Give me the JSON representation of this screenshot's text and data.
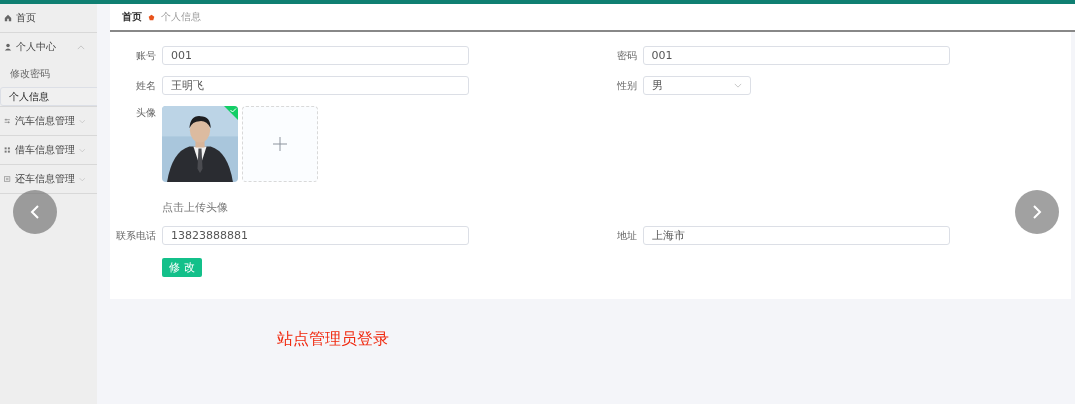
{
  "sidebar": {
    "items": [
      {
        "label": "首页"
      },
      {
        "label": "个人中心",
        "expanded": true,
        "children": [
          {
            "label": "修改密码",
            "selected": false
          },
          {
            "label": "个人信息",
            "selected": true
          }
        ]
      },
      {
        "label": "汽车信息管理",
        "expanded": false
      },
      {
        "label": "借车信息管理",
        "expanded": false
      },
      {
        "label": "还车信息管理",
        "expanded": false
      }
    ]
  },
  "breadcrumb": [
    {
      "label": "首页",
      "current": false
    },
    {
      "label": "个人信息",
      "current": true
    }
  ],
  "form": {
    "rows": [
      [
        {
          "kind": "text",
          "label": "账号",
          "value": "001"
        },
        {
          "kind": "text",
          "label": "密码",
          "value": "001"
        }
      ],
      [
        {
          "kind": "text",
          "label": "姓名",
          "value": "王明飞"
        },
        {
          "kind": "select",
          "label": "性别",
          "value": "男"
        }
      ],
      [
        {
          "kind": "upload",
          "label": "头像",
          "uploaded": true,
          "hint": "点击上传头像"
        }
      ],
      [
        {
          "kind": "text",
          "label": "联系电话",
          "value": "13823888881"
        },
        {
          "kind": "text",
          "label": "地址",
          "value": "上海市"
        }
      ]
    ],
    "submit": "修 改"
  },
  "carousel": {
    "caption": "站点管理员登录"
  }
}
